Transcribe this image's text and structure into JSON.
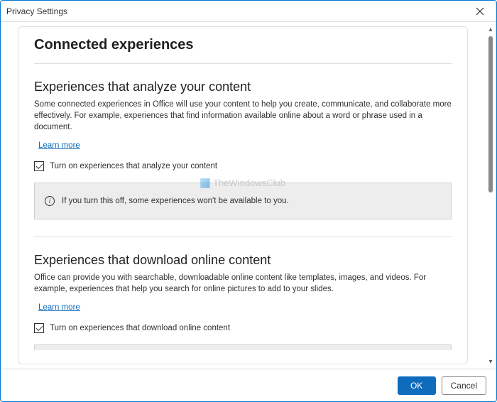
{
  "window": {
    "title": "Privacy Settings"
  },
  "page": {
    "heading": "Connected experiences"
  },
  "section1": {
    "heading": "Experiences that analyze your content",
    "desc": "Some connected experiences in Office will use your content to help you create, communicate, and collaborate more effectively. For example, experiences that find information available online about a word or phrase used in a document.",
    "learn_more": "Learn more",
    "checkbox_label": "Turn on experiences that analyze your content",
    "checkbox_checked": true,
    "info": "If you turn this off, some experiences won't be available to you."
  },
  "section2": {
    "heading": "Experiences that download online content",
    "desc": "Office can provide you with searchable, downloadable online content like templates, images, and videos. For example, experiences that help you search for online pictures to add to your slides.",
    "learn_more": "Learn more",
    "checkbox_label": "Turn on experiences that download online content",
    "checkbox_checked": true
  },
  "footer": {
    "ok": "OK",
    "cancel": "Cancel"
  },
  "watermark": "TheWindowsClub",
  "info_glyph": "i"
}
